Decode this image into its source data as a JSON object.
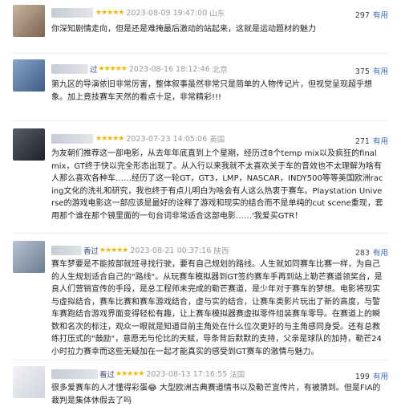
{
  "reviews": [
    {
      "stars": "★★★★★",
      "time": "2023-08-09 19:47:00",
      "location": "山东",
      "useful_count": "297",
      "useful_label": "有用",
      "name_suffix": "",
      "avatar_color": "#a38b74",
      "text": "你深知剧情走向，但是还是难掩最后激动的站起来，这就是运动题材的魅力"
    },
    {
      "stars": "★★★★★",
      "time": "2023-08-16 18:12:46",
      "location": "北京",
      "useful_count": "375",
      "useful_label": "有用",
      "name_suffix": "过",
      "avatar_color": "#5f7da6",
      "text": "第九区的导演依旧非常厉害，整体叙事虽然非常只是简单的人物传记片，但视觉呈现超乎想象。加上竟技赛车天然的看点十足，非常精彩!!!"
    },
    {
      "stars": "★★★★★",
      "time": "2023-07-23 14:05:06",
      "location": "英国",
      "useful_count": "271",
      "useful_label": "有用",
      "name_suffix": "",
      "avatar_color": "#3d3f47",
      "text": "为友朝们推荐这一部电影，从去年年底直到上个星期，经历过8个temp mix以及疯狂的final mix，GT终于快以完全形态出现了。从入行以来我就不太喜欢关于车的音效也不太理解为啥有人那么喜欢各种车……经历了这一轮GT，GT3，LMP，NASCAR，INDY500等等美国欧洲racing文化的洗礼和研究，我也终于有点儿明白为啥会有人这么热衷于赛车。Playstation Universe的游戏电影这一部应该是最好的诠释了游戏和现实的结合而不是单纯的cut scene重现，套用那个谁在那个镜里面的一句台词非常适合这部电影……'我爱买GTR！"
    },
    {
      "stars": "★★★★★",
      "time": "2023-08-21 00:37:16",
      "location": "陕西",
      "useful_count": "283",
      "useful_label": "有用",
      "name_suffix": "香过",
      "avatar_color": "#8a99ad",
      "text": "赛车梦要是不能按部就班寻找行驶，要有自己规划的路线。人生就如同赛车比赛一样，为自己的人生规划适合自己的\"路线\"。从玩赛车模拟器到GT签约赛车手再到站上勒芒赛道领奖台，是良人们营销宣传的手段，是总工程师未完成的勒芒赛道，是少年对于赛车的梦想。电影将现实与虚拟结合，赛车比赛和赛车游戏结合，虚与实的结合，让赛车类影片玩出了新的高度，与警车赛跑结合游戏界面变得轻松有趣，让上赛车模拟器赛虚拟零件组装赛车零导。在赛道上的瞬数和名次的标注，观众一眼就是知道目前主角处在什么位次更好的与主角感同身受。还有总教练打压式的\"鼓励\"，意愿无与伦比的天赋，导条背后默默的支持，父亲是球队的加持，勒芒24小时拉力赛幸而这些无疑加在一起才能真实的感受到GT赛车的激情与魅力。"
    },
    {
      "stars": "★★★★★",
      "time": "2023-08-13 17:16:55",
      "location": "法国",
      "useful_count": "199",
      "useful_label": "有用",
      "name_suffix": "看过",
      "avatar_color": "#e7e9ef",
      "text": "很多爱赛车的人才懂得彩蛋😂 大型欧洲古典赛道情书以及勒芒宣传片，有被猜到。但是FIA的裁判是集体休假去了吗"
    }
  ]
}
